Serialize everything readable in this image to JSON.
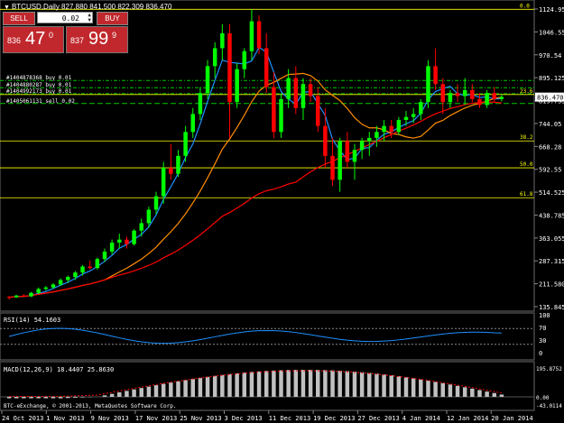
{
  "window": {
    "symbol_title": "BTCUSD,Daily  827.880 841.500 822.309 836.470"
  },
  "trade_panel": {
    "sell_label": "SELL",
    "buy_label": "BUY",
    "lot_value": "0.02",
    "bid_prefix": "836",
    "bid_big": "47",
    "bid_sup": "0",
    "ask_prefix": "837",
    "ask_big": "99",
    "ask_sup": "9"
  },
  "colors": {
    "background": "#000000",
    "bull_candle": "#00ff00",
    "bear_candle": "#ff0000",
    "fib_line": "#ffff00",
    "ma_fast": "#1e90ff",
    "ma_medium": "#ff8c00",
    "ma_slow": "#ff0000",
    "order_line": "#00c800",
    "rsi_line": "#1e90ff",
    "macd_hist": "#c0c0c0"
  },
  "orders": [
    "#1404878368 buy 0.01",
    "#1404880287 buy 0.01",
    "#1404992173 buy 0.01",
    "#1405061131 sell 0.02"
  ],
  "fib_levels": [
    "0.0",
    "23.6",
    "38.2",
    "50.0",
    "61.8"
  ],
  "price_axis": {
    "ticks": [
      "1124.95",
      "1046.555",
      "970.54",
      "895.125",
      "819.755",
      "744.05",
      "668.28",
      "592.55",
      "514.525",
      "438.785",
      "363.055",
      "287.315",
      "211.580",
      "135.845"
    ],
    "current_price": "836.470"
  },
  "date_axis": {
    "ticks": [
      "24 Oct 2013",
      "1 Nov 2013",
      "9 Nov 2013",
      "17 Nov 2013",
      "25 Nov 2013",
      "3 Dec 2013",
      "11 Dec 2013",
      "19 Dec 2013",
      "27 Dec 2013",
      "4 Jan 2014",
      "12 Jan 2014",
      "20 Jan 2014"
    ]
  },
  "rsi": {
    "label": "RSI(14) 54.1603",
    "axis": [
      "100",
      "70",
      "30",
      "0"
    ]
  },
  "macd": {
    "label": "MACD(12,26,9) 18.4407 25.8630",
    "axis": [
      "195.8752",
      "0.00",
      "-43.0114"
    ]
  },
  "copyright": "BTC-eExchange, © 2001-2013, MetaQuotes Software Corp.",
  "chart_data": {
    "type": "candlestick",
    "series": [
      {
        "name": "BTCUSD",
        "values": [
          [
            168,
            172,
            160,
            167
          ],
          [
            167,
            175,
            165,
            173
          ],
          [
            173,
            178,
            170,
            170
          ],
          [
            170,
            185,
            168,
            182
          ],
          [
            182,
            200,
            178,
            195
          ],
          [
            195,
            205,
            190,
            200
          ],
          [
            200,
            215,
            196,
            210
          ],
          [
            210,
            230,
            205,
            225
          ],
          [
            225,
            240,
            215,
            235
          ],
          [
            235,
            255,
            225,
            250
          ],
          [
            250,
            275,
            240,
            270
          ],
          [
            270,
            290,
            260,
            265
          ],
          [
            265,
            300,
            260,
            295
          ],
          [
            295,
            330,
            285,
            320
          ],
          [
            320,
            360,
            310,
            350
          ],
          [
            350,
            380,
            330,
            360
          ],
          [
            360,
            370,
            330,
            345
          ],
          [
            345,
            395,
            340,
            390
          ],
          [
            390,
            430,
            370,
            415
          ],
          [
            415,
            470,
            400,
            460
          ],
          [
            460,
            520,
            445,
            505
          ],
          [
            505,
            620,
            480,
            600
          ],
          [
            600,
            680,
            560,
            580
          ],
          [
            580,
            660,
            570,
            640
          ],
          [
            640,
            740,
            620,
            720
          ],
          [
            720,
            800,
            700,
            780
          ],
          [
            780,
            870,
            760,
            850
          ],
          [
            850,
            960,
            830,
            940
          ],
          [
            940,
            1020,
            900,
            1000
          ],
          [
            1000,
            1080,
            960,
            1050
          ],
          [
            1050,
            1080,
            700,
            820
          ],
          [
            820,
            950,
            800,
            930
          ],
          [
            930,
            1000,
            900,
            990
          ],
          [
            990,
            1130,
            960,
            1090
          ],
          [
            1090,
            1110,
            980,
            1000
          ],
          [
            1000,
            1050,
            850,
            870
          ],
          [
            870,
            920,
            700,
            720
          ],
          [
            720,
            850,
            700,
            830
          ],
          [
            830,
            930,
            800,
            900
          ],
          [
            900,
            940,
            780,
            800
          ],
          [
            800,
            900,
            760,
            880
          ],
          [
            880,
            900,
            820,
            840
          ],
          [
            840,
            870,
            720,
            740
          ],
          [
            740,
            800,
            600,
            640
          ],
          [
            640,
            700,
            540,
            560
          ],
          [
            560,
            700,
            520,
            690
          ],
          [
            690,
            720,
            600,
            620
          ],
          [
            620,
            680,
            560,
            660
          ],
          [
            660,
            700,
            630,
            690
          ],
          [
            690,
            720,
            640,
            700
          ],
          [
            700,
            740,
            670,
            720
          ],
          [
            720,
            760,
            690,
            740
          ],
          [
            740,
            760,
            700,
            720
          ],
          [
            720,
            770,
            710,
            760
          ],
          [
            760,
            790,
            740,
            770
          ],
          [
            770,
            800,
            750,
            780
          ],
          [
            780,
            830,
            760,
            820
          ],
          [
            820,
            960,
            800,
            940
          ],
          [
            940,
            1000,
            860,
            880
          ],
          [
            880,
            900,
            780,
            820
          ],
          [
            820,
            860,
            800,
            850
          ],
          [
            850,
            880,
            820,
            840
          ],
          [
            840,
            900,
            810,
            860
          ],
          [
            860,
            880,
            820,
            830
          ],
          [
            830,
            850,
            800,
            810
          ],
          [
            810,
            860,
            800,
            850
          ],
          [
            850,
            870,
            820,
            830
          ],
          [
            830,
            845,
            822,
            837
          ]
        ]
      }
    ],
    "fib_retracement": {
      "0.0": 1130,
      "23.6": 845,
      "38.2": 690,
      "50.0": 600,
      "61.8": 500
    },
    "ylim": [
      135.845,
      1124.95
    ],
    "rsi_last": 54.1603,
    "macd": {
      "main": 18.4407,
      "signal": 25.863
    }
  }
}
